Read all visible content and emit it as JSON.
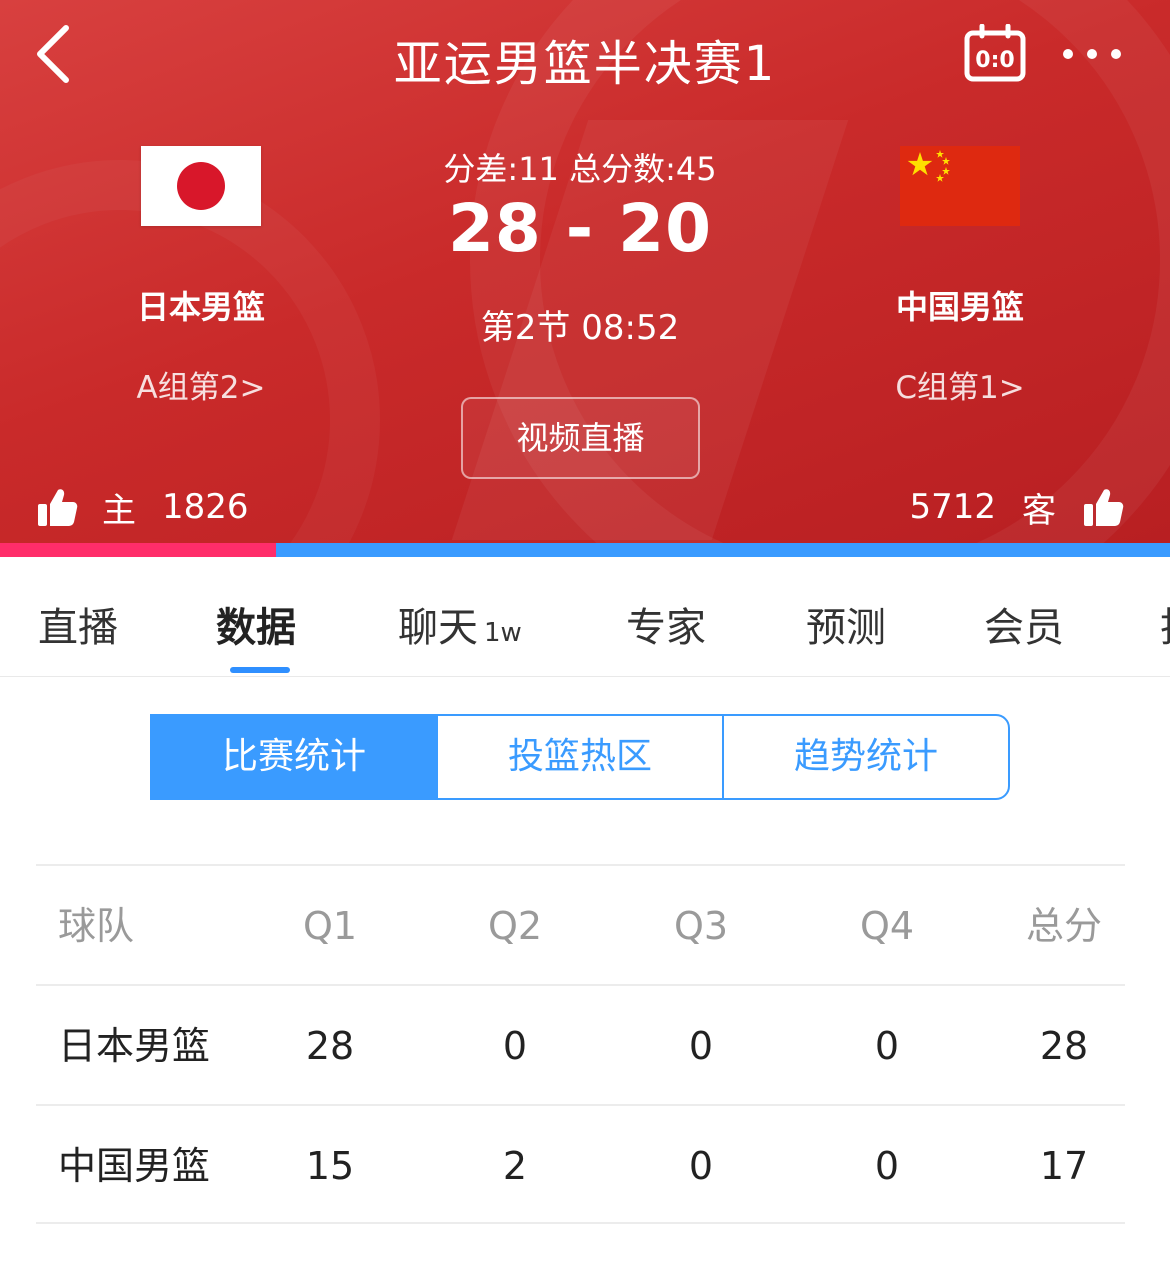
{
  "header": {
    "title": "亚运男篮半决赛1",
    "diff_line": "分差:11 总分数:45",
    "score_line": "28 - 20",
    "period_line": "第2节 08:52",
    "video_button": "视频直播"
  },
  "home": {
    "name": "日本男篮",
    "group": "A组第2>",
    "flag": "japan-flag",
    "like_label": "主",
    "likes": "1826"
  },
  "away": {
    "name": "中国男篮",
    "group": "C组第1>",
    "flag": "china-flag",
    "like_label": "客",
    "likes": "5712"
  },
  "vote": {
    "home_share": 0.236,
    "home_color": "#ff2d6a",
    "away_color": "#3a9bff"
  },
  "tabs": [
    {
      "label": "直播"
    },
    {
      "label": "数据",
      "active": true
    },
    {
      "label": "聊天",
      "badge": "1w"
    },
    {
      "label": "专家"
    },
    {
      "label": "预测"
    },
    {
      "label": "会员"
    },
    {
      "label": "投"
    }
  ],
  "segments": [
    {
      "label": "比赛统计",
      "active": true
    },
    {
      "label": "投篮热区"
    },
    {
      "label": "趋势统计"
    }
  ],
  "table": {
    "headers": [
      "球队",
      "Q1",
      "Q2",
      "Q3",
      "Q4",
      "总分"
    ],
    "rows": [
      [
        "日本男篮",
        "28",
        "0",
        "0",
        "0",
        "28"
      ],
      [
        "中国男篮",
        "15",
        "2",
        "0",
        "0",
        "17"
      ]
    ]
  },
  "colors": {
    "header_red": "#c92a2a",
    "accent_blue": "#3a9bff",
    "accent_pink": "#ff2d6a"
  },
  "icons": [
    "back-arrow-icon",
    "scoreboard-icon",
    "more-icon",
    "thumbs-up-icon"
  ]
}
